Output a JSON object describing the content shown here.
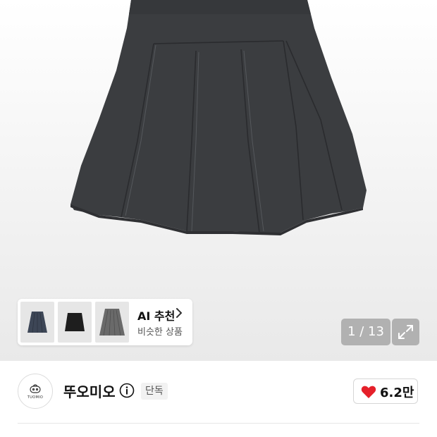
{
  "product_image": {
    "description_icon": "pleated-skirt-image",
    "skirt_color": "#3b3d40"
  },
  "ai_recommend": {
    "title": "AI 추천",
    "subtitle": "비슷한 상품",
    "chevron_icon": "chevron-right-icon",
    "thumbnails": [
      {
        "icon": "navy-pleated-skirt-thumbnail",
        "color": "#3d4656"
      },
      {
        "icon": "black-skirt-thumbnail",
        "color": "#1e1e1e"
      },
      {
        "icon": "gray-pleated-skirt-thumbnail",
        "color": "#6a6a6a"
      }
    ]
  },
  "gallery": {
    "pager": "1 / 13",
    "expand_icon": "expand-icon"
  },
  "brand": {
    "logo_text": "TUOMIO",
    "name": "뚜오미오",
    "info_icon": "info-icon",
    "badge": "단독"
  },
  "like": {
    "icon": "heart-icon",
    "count": "6.2만",
    "heart_color": "#e5202a"
  }
}
